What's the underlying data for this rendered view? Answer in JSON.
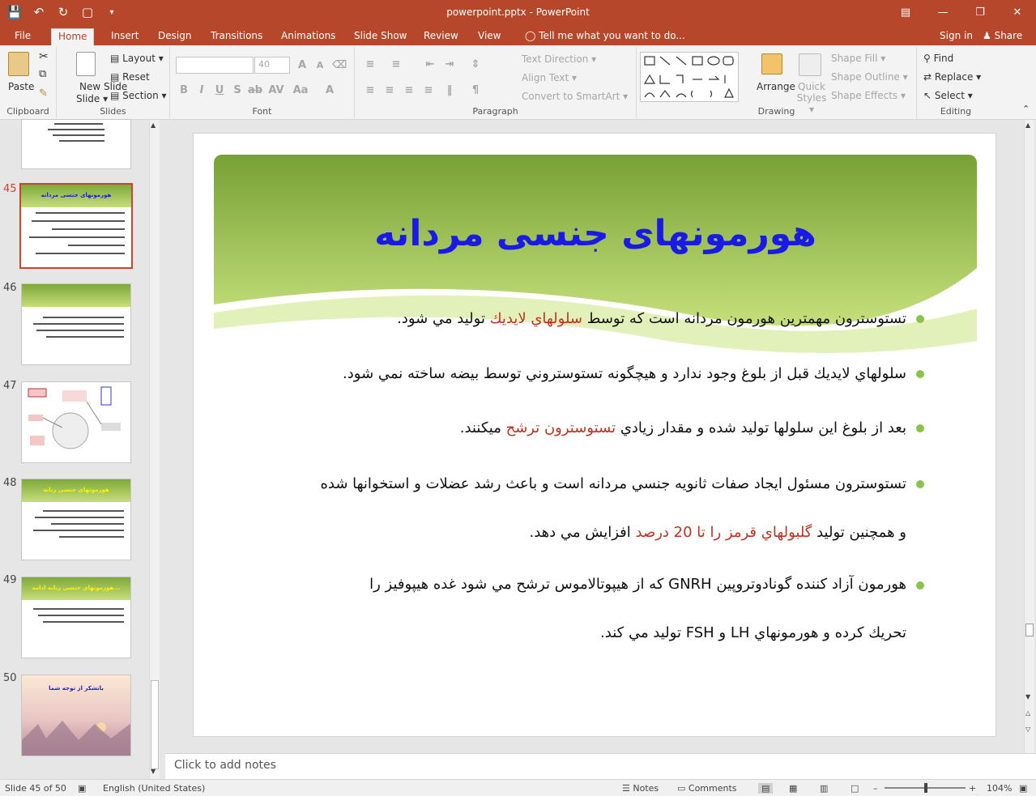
{
  "titlebar": {
    "doc_title": "powerpoint.pptx - PowerPoint"
  },
  "tabs": [
    "File",
    "Home",
    "Insert",
    "Design",
    "Transitions",
    "Animations",
    "Slide Show",
    "Review",
    "View"
  ],
  "tell_me": "Tell me what you want to do...",
  "signin": "Sign in",
  "share": "Share",
  "ribbon": {
    "clipboard": {
      "label": "Clipboard",
      "paste": "Paste"
    },
    "slides": {
      "label": "Slides",
      "new_slide": "New Slide",
      "new_slide_arrow": "Slide ▾",
      "layout": "Layout ▾",
      "reset": "Reset",
      "section": "Section ▾"
    },
    "font": {
      "label": "Font",
      "font_name": "",
      "font_size": "40"
    },
    "paragraph": {
      "label": "Paragraph",
      "text_direction": "Text Direction ▾",
      "align_text": "Align Text ▾",
      "convert_smartart": "Convert to SmartArt ▾"
    },
    "drawing": {
      "label": "Drawing",
      "arrange": "Arrange",
      "quick_styles": "Quick Styles ▾",
      "shape_fill": "Shape Fill ▾",
      "shape_outline": "Shape Outline ▾",
      "shape_effects": "Shape Effects ▾"
    },
    "editing": {
      "label": "Editing",
      "find": "Find",
      "replace": "Replace ▾",
      "select": "Select ▾"
    }
  },
  "thumbnails": [
    {
      "num": "",
      "title": "",
      "selected": false
    },
    {
      "num": "45",
      "title": "هورمونهای جنسی مردانه",
      "selected": true
    },
    {
      "num": "46",
      "title": "",
      "selected": false
    },
    {
      "num": "47",
      "title": "",
      "selected": false
    },
    {
      "num": "48",
      "title": "هورمونهای جنسی زنانه",
      "selected": false
    },
    {
      "num": "49",
      "title": "هورمونهای جنسی زنانه ادامه...",
      "selected": false
    },
    {
      "num": "50",
      "title": "باتشکر از توجه شما",
      "selected": false
    }
  ],
  "slide": {
    "title": "هورمونهای جنسی مردانه",
    "b1a": "تستوسترون مهمترين هورمون مردانه است كه توسط ",
    "b1r": "سلولهاي لايديك",
    "b1b": " توليد مي شود.",
    "b2": "سلولهاي لايديك قبل از بلوغ وجود ندارد و هيچگونه تستوستروني توسط بيضه ساخته نمي شود.",
    "b3a": "بعد از بلوغ اين سلولها توليد شده و مقدار زيادي ",
    "b3r": "تستوسترون ترشح",
    "b3b": " ميكنند.",
    "b4l1": "تستوسترون مسئول ايجاد صفات ثانويه جنسي مردانه است و باعث رشد عضلات و استخوانها شده",
    "b4l2a": "و همچنين توليد ",
    "b4l2r": "گلبولهاي قرمز را تا 20 درصد",
    "b4l2b": " افزايش مي دهد.",
    "b5l1": "هورمون آزاد كننده گونادوتروپين GNRH  كه از هيپوتالاموس ترشح مي شود غده هيپوفيز را",
    "b5l2": "تحريك كرده و هورمونهاي LH  و FSH توليد مي كند."
  },
  "notes_placeholder": "Click to add notes",
  "status": {
    "slide": "Slide 45 of 50",
    "language": "English (United States)",
    "notes": "Notes",
    "comments": "Comments",
    "zoom": "104%",
    "zoom_level": 104
  },
  "colors": {
    "accent": "#b7472a",
    "title": "#1a1ae6",
    "highlight": "#c0311f",
    "bullet": "#8bc34a"
  }
}
